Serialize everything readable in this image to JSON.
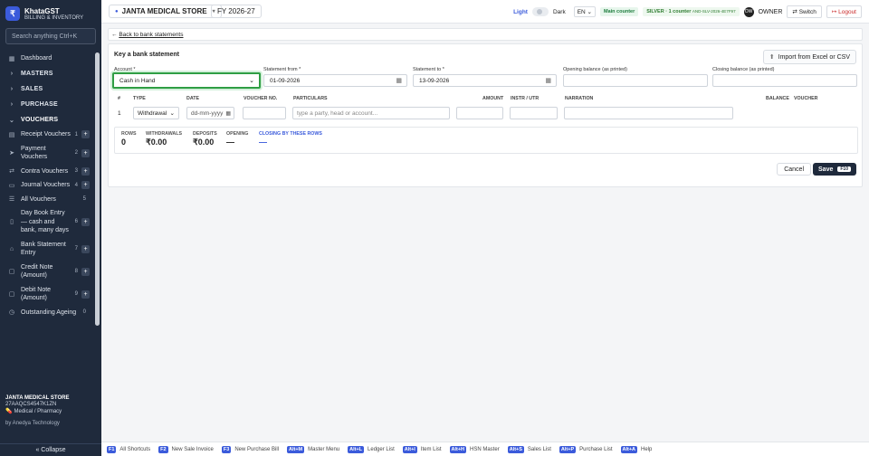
{
  "brand": {
    "name": "KhataGST",
    "subtitle": "BILLING & INVENTORY"
  },
  "sidebar": {
    "search_placeholder": "Search anything   Ctrl+K",
    "dashboard": "Dashboard",
    "sections": [
      {
        "label": "MASTERS"
      },
      {
        "label": "SALES"
      },
      {
        "label": "PURCHASE"
      },
      {
        "label": "VOUCHERS"
      }
    ],
    "vouchers": [
      {
        "label": "Receipt Vouchers",
        "num": "1"
      },
      {
        "label": "Payment Vouchers",
        "num": "2"
      },
      {
        "label": "Contra Vouchers",
        "num": "3"
      },
      {
        "label": "Journal Vouchers",
        "num": "4"
      },
      {
        "label": "All Vouchers",
        "num": "5"
      },
      {
        "label": "Day Book Entry — cash and bank, many days",
        "num": "6"
      },
      {
        "label": "Bank Statement Entry",
        "num": "7"
      },
      {
        "label": "Credit Note (Amount)",
        "num": "8"
      },
      {
        "label": "Debit Note (Amount)",
        "num": "9"
      },
      {
        "label": "Outstanding Ageing",
        "num": "0"
      }
    ],
    "footer": {
      "store": "JANTA MEDICAL STORE",
      "gstin": "27AAQCS4547K1ZN",
      "type": "Medical / Pharmacy",
      "by": "by Anedya Technology"
    },
    "collapse": "« Collapse"
  },
  "topbar": {
    "store": "JANTA MEDICAL STORE",
    "fy": "FY 2026-27",
    "light": "Light",
    "dark": "Dark",
    "lang": "EN",
    "main_counter": "Main counter",
    "plan": "SILVER · 1 counter",
    "plan_code": "AND-SLV-2026-4E7F97",
    "owner_initials": "OW",
    "owner": "OWNER",
    "switch": "Switch",
    "logout": "Logout"
  },
  "back": "Back to bank statements",
  "form": {
    "title": "Key a bank statement",
    "import": "Import from Excel or CSV",
    "account_label": "Account *",
    "account_value": "Cash in Hand",
    "from_label": "Statement from *",
    "from_value": "01-09-2026",
    "to_label": "Statement to *",
    "to_value": "13-09-2026",
    "opening_label": "Opening balance (as printed)",
    "closing_label": "Closing balance (as printed)"
  },
  "grid": {
    "headers": {
      "num": "#",
      "type": "TYPE",
      "date": "DATE",
      "vno": "VOUCHER NO.",
      "particulars": "PARTICULARS",
      "amount": "AMOUNT",
      "instr": "INSTR / UTR",
      "narration": "NARRATION",
      "balance": "BALANCE",
      "voucher": "VOUCHER"
    },
    "row": {
      "num": "1",
      "type": "Withdrawal",
      "date_placeholder": "dd-mm-yyyy",
      "particulars_placeholder": "type a party, head or account..."
    }
  },
  "summary": {
    "rows_l": "ROWS",
    "rows_v": "0",
    "withdrawals_l": "WITHDRAWALS",
    "withdrawals_v": "₹0.00",
    "deposits_l": "DEPOSITS",
    "deposits_v": "₹0.00",
    "opening_l": "OPENING",
    "opening_v": "—",
    "closing_l": "CLOSING BY THESE ROWS",
    "closing_v": "—"
  },
  "actions": {
    "cancel": "Cancel",
    "save": "Save",
    "save_key": "F10"
  },
  "shortcuts": [
    {
      "key": "F1",
      "label": "All Shortcuts"
    },
    {
      "key": "F2",
      "label": "New Sale Invoice"
    },
    {
      "key": "F3",
      "label": "New Purchase Bill"
    },
    {
      "key": "Alt+M",
      "label": "Master Menu"
    },
    {
      "key": "Alt+L",
      "label": "Ledger List"
    },
    {
      "key": "Alt+I",
      "label": "Item List"
    },
    {
      "key": "Alt+H",
      "label": "HSN Master"
    },
    {
      "key": "Alt+S",
      "label": "Sales List"
    },
    {
      "key": "Alt+P",
      "label": "Purchase List"
    },
    {
      "key": "Alt+A",
      "label": "Help"
    }
  ],
  "colors": {
    "sidebar": "#1f2a3c",
    "accent": "#3b5bdb",
    "focus": "#2f9e44"
  }
}
